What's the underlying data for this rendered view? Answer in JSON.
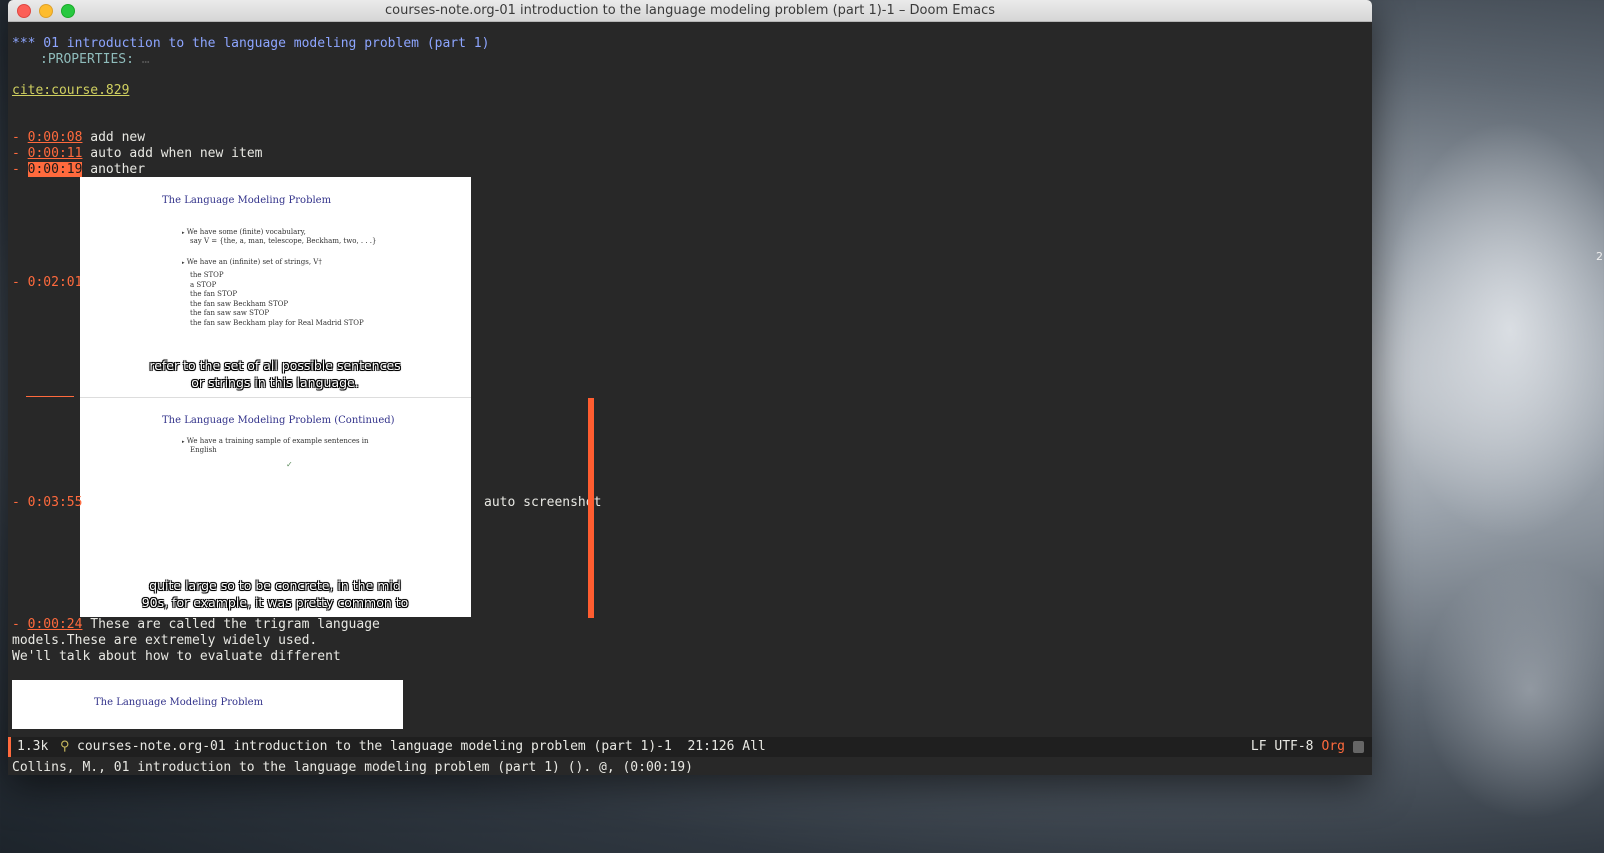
{
  "window": {
    "title": "courses-note.org-01 introduction to the language modeling problem (part 1)-1 – Doom Emacs"
  },
  "buffer": {
    "heading": "*** 01 introduction to the language modeling problem (part 1)",
    "properties": ":PROPERTIES:",
    "properties_fold": "…",
    "cite": "cite:course.829",
    "items": [
      {
        "dash": "- ",
        "time": "0:00:08",
        "text": " add new"
      },
      {
        "dash": "- ",
        "time": "0:00:11",
        "text": " auto add when new item"
      },
      {
        "dash": "- ",
        "time": "0:00:19",
        "text": " another"
      },
      {
        "dash": "- ",
        "time": "0:02:01"
      },
      {
        "dash": "- ",
        "time": "0:03:55",
        "text": "auto screenshot"
      },
      {
        "dash": "- ",
        "time": "0:00:24",
        "text": " These are called the trigram language"
      }
    ],
    "cont_line_1": "models.These are extremely widely used.",
    "cont_line_2": "We'll talk about how to evaluate different"
  },
  "slides": {
    "slide1": {
      "title": "The Language Modeling Problem",
      "bullet_marker": "▸",
      "bullet1_a": "We have some (finite) vocabulary,",
      "bullet1_b": "say V = {the, a, man, telescope, Beckham, two, . . .}",
      "bullet2": "We have an (infinite) set of strings, V†",
      "strings": [
        "the STOP",
        "a STOP",
        "the fan STOP",
        "the fan saw Beckham STOP",
        "the fan saw saw STOP",
        "the fan saw Beckham play for Real Madrid STOP"
      ],
      "caption_1": "refer to the set of all possible sentences",
      "caption_2": "or strings in this language."
    },
    "slide2": {
      "title": "The Language Modeling Problem (Continued)",
      "bullet_a": "We have a training sample of example sentences in",
      "bullet_b": "English",
      "caption_1": "quite large so to be concrete, in the mid",
      "caption_2": "90s, for example, it was pretty common to"
    },
    "slide3": {
      "title": "The Language Modeling Problem"
    }
  },
  "modeline": {
    "size": "1.3k",
    "icon": "⚲",
    "name": "courses-note.org-01 introduction to the language modeling problem (part 1)-1  21:126 All",
    "encoding": "LF UTF-8",
    "mode": "Org"
  },
  "echo": "Collins, M., 01 introduction to the language modeling problem (part 1) (). @, (0:00:19)",
  "colors": {
    "accent": "#ff6a3d",
    "heading": "#8da5ff",
    "bg": "#282828"
  }
}
